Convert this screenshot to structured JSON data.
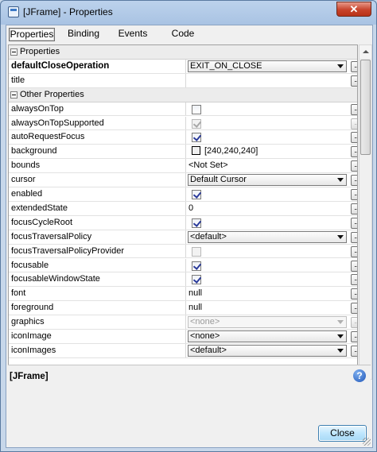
{
  "window": {
    "title": "[JFrame] - Properties",
    "close_glyph": "✕"
  },
  "tabs": [
    {
      "label": "Properties",
      "active": true
    },
    {
      "label": "Binding",
      "active": false
    },
    {
      "label": "Events",
      "active": false
    },
    {
      "label": "Code",
      "active": false
    }
  ],
  "rows": [
    {
      "type": "category",
      "name": "Properties"
    },
    {
      "type": "combo",
      "name": "defaultCloseOperation",
      "bold": true,
      "value": "EXIT_ON_CLOSE",
      "button": true
    },
    {
      "type": "text",
      "name": "title",
      "value": "",
      "button": true
    },
    {
      "type": "category",
      "name": "Other Properties"
    },
    {
      "type": "check",
      "name": "alwaysOnTop",
      "checked": false,
      "button": true
    },
    {
      "type": "check",
      "name": "alwaysOnTopSupported",
      "checked": true,
      "disabled": true,
      "button": false
    },
    {
      "type": "check",
      "name": "autoRequestFocus",
      "checked": true,
      "button": true
    },
    {
      "type": "color",
      "name": "background",
      "value": "[240,240,240]",
      "button": true
    },
    {
      "type": "text",
      "name": "bounds",
      "value": "<Not Set>",
      "button": true
    },
    {
      "type": "combo",
      "name": "cursor",
      "value": "Default Cursor",
      "button": true
    },
    {
      "type": "check",
      "name": "enabled",
      "checked": true,
      "button": true
    },
    {
      "type": "text",
      "name": "extendedState",
      "value": "0",
      "button": true
    },
    {
      "type": "check",
      "name": "focusCycleRoot",
      "checked": true,
      "button": true
    },
    {
      "type": "combo",
      "name": "focusTraversalPolicy",
      "value": "<default>",
      "button": true
    },
    {
      "type": "check",
      "name": "focusTraversalPolicyProvider",
      "checked": false,
      "disabled": true,
      "button": true
    },
    {
      "type": "check",
      "name": "focusable",
      "checked": true,
      "button": true
    },
    {
      "type": "check",
      "name": "focusableWindowState",
      "checked": true,
      "button": true
    },
    {
      "type": "text",
      "name": "font",
      "value": "null",
      "button": true
    },
    {
      "type": "text",
      "name": "foreground",
      "value": "null",
      "button": true
    },
    {
      "type": "combo",
      "name": "graphics",
      "value": "<none>",
      "disabled": true,
      "button": false
    },
    {
      "type": "combo",
      "name": "iconImage",
      "value": "<none>",
      "button": true
    },
    {
      "type": "combo",
      "name": "iconImages",
      "value": "<default>",
      "button": true
    }
  ],
  "description": {
    "title": "[JFrame]",
    "help_glyph": "?"
  },
  "footer": {
    "close_label": "Close"
  },
  "colors": {
    "accent": "#3c7fb1",
    "title_bar": "#bcd2ec",
    "close_red": "#c7432b"
  }
}
